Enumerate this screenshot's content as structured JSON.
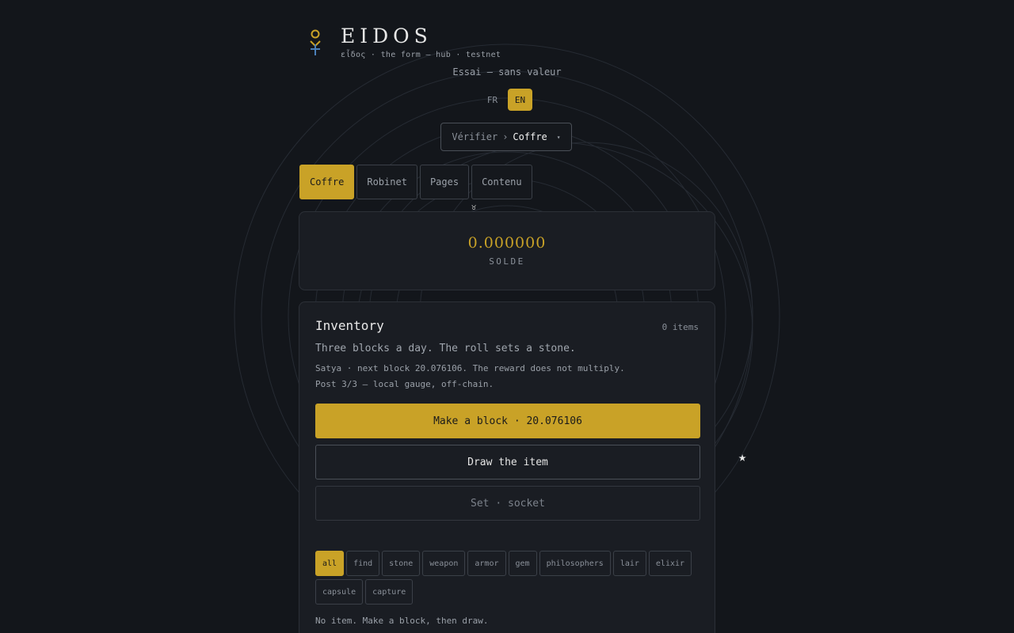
{
  "brand": {
    "title": "EIDOS",
    "subtitle": "εἶδος · the form — hub · testnet"
  },
  "tagline": "Essai — sans valeur",
  "language": {
    "options": [
      "FR",
      "EN"
    ],
    "active": "EN"
  },
  "route": {
    "parent": "Vérifier",
    "separator": "›",
    "current": "Coffre",
    "caret": "▾"
  },
  "tabs": [
    {
      "label": "Coffre",
      "active": true
    },
    {
      "label": "Robinet",
      "active": false
    },
    {
      "label": "Pages",
      "active": false
    },
    {
      "label": "Contenu",
      "active": false
    }
  ],
  "glyph": "♉",
  "balance": {
    "value": "0.000000",
    "label": "SOLDE"
  },
  "inventory": {
    "title": "Inventory",
    "count": "0 items",
    "lead": "Three blocks a day. The roll sets a stone.",
    "note_line1": "Satya · next block 20.076106. The reward does not multiply.",
    "note_line2": "Post 3/3 — local gauge, off-chain.",
    "make_block_label": "Make a block · 20.076106",
    "draw_label": "Draw the item",
    "set_socket_label": "Set · socket",
    "filters": [
      "all",
      "find",
      "stone",
      "weapon",
      "armor",
      "gem",
      "philosophers",
      "lair",
      "elixir",
      "capsule",
      "capture"
    ],
    "active_filter": "all",
    "empty_text": "No item. Make a block, then draw."
  },
  "decor": {
    "star": "★"
  },
  "colors": {
    "accent": "#c9a227",
    "background": "#13161b",
    "card": "#1a1d23"
  }
}
